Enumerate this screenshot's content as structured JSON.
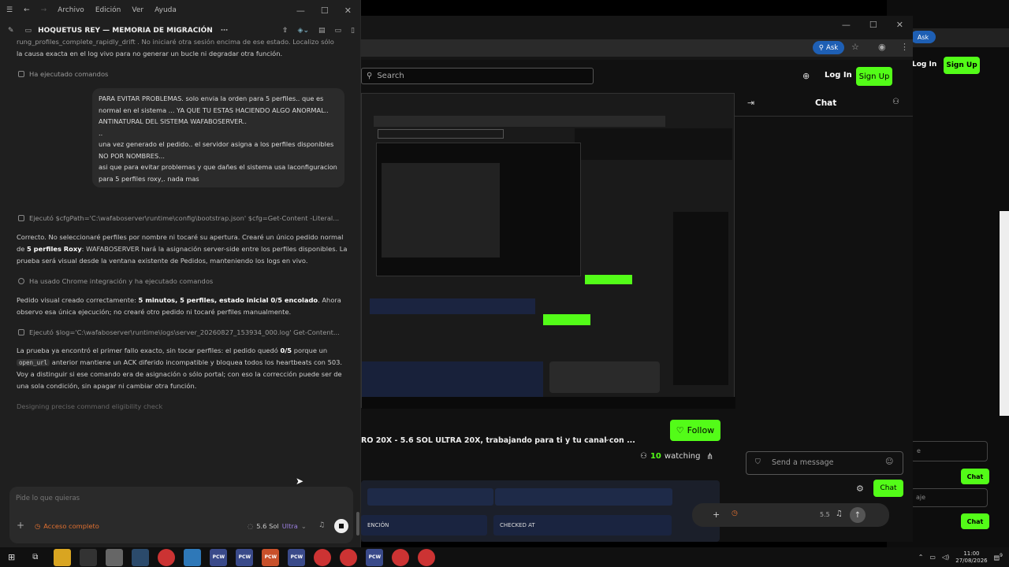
{
  "menu": {
    "file": "Archivo",
    "edit": "Edición",
    "view": "Ver",
    "help": "Ayuda"
  },
  "chat": {
    "title": "HOQUETUS REY — MEMORIA DE MIGRACIÓN",
    "top_text_1": "rung_profiles_complete_rapidly_drift . No iniciaré otra sesión encima de ese estado. Localizo sólo",
    "top_text_2": "la causa exacta en el log vivo para no generar un bucle ni degradar otra función.",
    "tool1": "Ha ejecutado comandos",
    "user_lines": [
      "PARA EVITAR PROBLEMAS. solo envia la orden para 5 perfiles.. que es",
      "normal en el sistema ... YA QUE TU ESTAS HACIENDO ALGO ANORMAL..",
      "ANTINATURAL DEL SISTEMA WAFABOSERVER..",
      "..",
      "una vez generado el pedido.. el servidor asigna a los perfiles disponibles",
      "NO POR NOMBRES...",
      "asi que para evitar problemas y que dañes el sistema usa laconfiguracion",
      "para 5 perfiles roxy,. nada mas"
    ],
    "tool2": "Ejecutó $cfgPath='C:\\wafaboserver\\runtime\\config\\bootstrap.json' $cfg=Get-Content -Literal...",
    "p1_a": "Correcto. No seleccionaré perfiles por nombre ni tocaré su apertura. Crearé un único pedido normal",
    "p1_b_pre": "de ",
    "p1_b_bold": "5 perfiles Roxy",
    "p1_b_post": ": WAFABOSERVER hará la asignación server-side entre los perfiles disponibles. La",
    "p1_c": "prueba será visual desde la ventana existente de Pedidos, manteniendo los logs en vivo.",
    "tool3": "Ha usado Chrome integración y ha ejecutado comandos",
    "p2_a_pre": "Pedido visual creado correctamente: ",
    "p2_a_bold": "5 minutos, 5 perfiles, estado inicial 0/5 encolado",
    ". Ahora": "",
    "p2_a_post": ". Ahora",
    "p2_b": "observo esa única ejecución; no crearé otro pedido ni tocaré perfiles manualmente.",
    "tool4": "Ejecutó $log='C:\\wafaboserver\\runtime\\logs\\server_20260827_153934_000.log' Get-Content...",
    "p3_a_pre": "La prueba ya encontró el primer fallo exacto, sin tocar perfiles: el pedido quedó ",
    "p3_a_bold": "0/5",
    " p3_a_post": "",
    "p3_a_post": " porque un",
    "p3_b_code": "open_url",
    "p3_b_post": " anterior mantiene un ACK diferido incompatible y bloquea todos los heartbeats con 503.",
    "p3_c": "Voy a distinguir si ese comando era de asignación o sólo portal; con eso la corrección puede ser de",
    "p3_d": "una sola condición, sin apagar ni cambiar otra función.",
    "status": "Designing precise command eligibility check",
    "input_placeholder": "Pide lo que quieras",
    "access": "Acceso completo",
    "model": "5.6 Sol",
    "model_variant": "Ultra"
  },
  "stream": {
    "search_placeholder": "Search",
    "ask": "Ask",
    "login": "Log In",
    "signup": "Sign Up",
    "chat_title": "Chat",
    "follow": "Follow",
    "stream_title": "RO 20X - 5.6 SOL ULTRA 20X, trabajando para ti y tu canal con ...",
    "watching_count": "10",
    "watching_label": "watching",
    "send_placeholder": "Send a message",
    "chat_button": "Chat",
    "col1": "ENCIÓN",
    "col2": "CHECKED AT",
    "volume": "5.5",
    "far_placeholder_1": "e",
    "far_placeholder_2": "aje"
  },
  "clock": {
    "time": "11:00",
    "date": "27/08/2026"
  },
  "notif_count": "9",
  "colors": {
    "accent": "#53fc18",
    "panel": "#1f1f1f"
  }
}
